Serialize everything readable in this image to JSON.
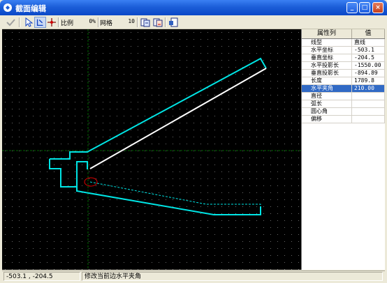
{
  "window": {
    "title": "截面编辑",
    "min_icon": "minimize-icon",
    "max_icon": "maximize-icon",
    "close_icon": "close-icon"
  },
  "toolbar": {
    "scale_label": "比例",
    "scale_value": "0%",
    "grid_label": "网格",
    "grid_value": "10",
    "icons": [
      "check-icon",
      "pointer-icon",
      "edit-shape-icon",
      "crosshair-icon",
      "copy-section-icon",
      "paste-section-icon",
      "export-icon"
    ]
  },
  "property_grid": {
    "headers": {
      "name": "属性列",
      "value": "值"
    },
    "rows": [
      {
        "name": "线型",
        "value": "直线"
      },
      {
        "name": "水平坐标",
        "value": "-503.1"
      },
      {
        "name": "垂直坐标",
        "value": "-204.5"
      },
      {
        "name": "水平投影长",
        "value": "-1550.00"
      },
      {
        "name": "垂直投影长",
        "value": "-894.89"
      },
      {
        "name": "长度",
        "value": "1789.8"
      },
      {
        "name": "水平夹角",
        "value": "210.00"
      },
      {
        "name": "直径",
        "value": ""
      },
      {
        "name": "弧长",
        "value": ""
      },
      {
        "name": "圆心角",
        "value": ""
      },
      {
        "name": "偏移",
        "value": ""
      }
    ],
    "selected_index": 6
  },
  "status": {
    "coords": "-503.1 ,  -204.5",
    "message": "修改当前边水平夹角"
  },
  "colors": {
    "canvas_bg": "#000000",
    "section_line": "#00e5e5",
    "selected_edge": "#ffffff",
    "axis_line": "#006400",
    "highlight_circle": "#e00000"
  }
}
